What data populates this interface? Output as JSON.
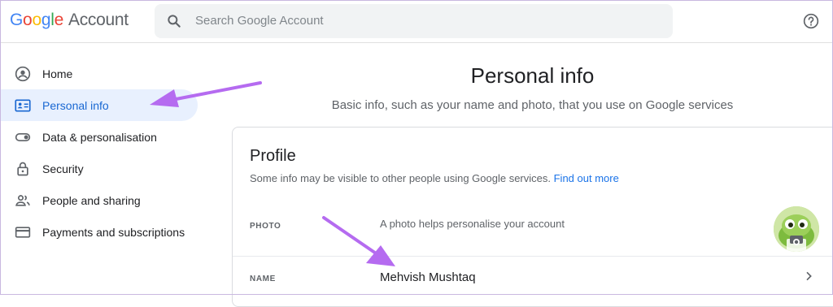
{
  "header": {
    "logo_google": "Google",
    "logo_account": "Account",
    "search_placeholder": "Search Google Account"
  },
  "sidebar": {
    "items": [
      {
        "label": "Home",
        "icon": "account-circle-icon",
        "active": false
      },
      {
        "label": "Personal info",
        "icon": "id-card-icon",
        "active": true
      },
      {
        "label": "Data & personalisation",
        "icon": "toggle-icon",
        "active": false
      },
      {
        "label": "Security",
        "icon": "lock-icon",
        "active": false
      },
      {
        "label": "People and sharing",
        "icon": "people-icon",
        "active": false
      },
      {
        "label": "Payments and subscriptions",
        "icon": "credit-card-icon",
        "active": false
      }
    ]
  },
  "main": {
    "title": "Personal info",
    "subtitle": "Basic info, such as your name and photo, that you use on Google services"
  },
  "profile": {
    "heading": "Profile",
    "description": "Some info may be visible to other people using Google services.",
    "link": "Find out more",
    "photo_label": "PHOTO",
    "photo_value": "A photo helps personalise your account",
    "name_label": "NAME",
    "name_value": "Mehvish Mushtaq"
  },
  "colors": {
    "accent": "#1a73e8",
    "active_bg": "#e8f0fe",
    "arrow": "#b56bf0"
  }
}
